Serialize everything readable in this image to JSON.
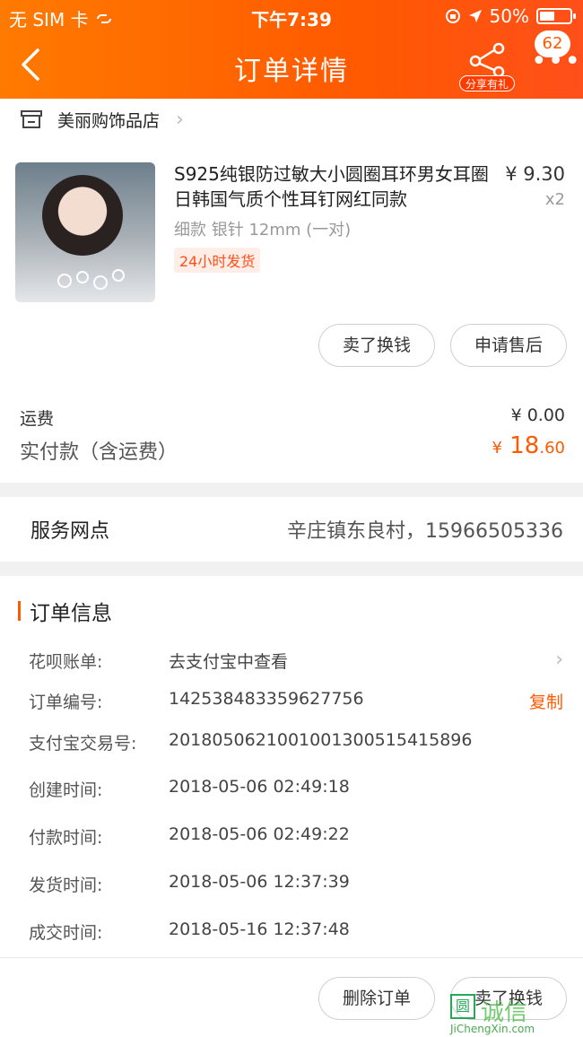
{
  "status_bar": {
    "carrier": "无 SIM 卡",
    "time": "下午7:39",
    "battery": "50%"
  },
  "nav": {
    "title": "订单详情",
    "share_label": "分享有礼",
    "badge": "62"
  },
  "store": {
    "name": "美丽购饰品店"
  },
  "item": {
    "name": "S925纯银防过敏大小圆圈耳环男女耳圈日韩国气质个性耳钉网红同款",
    "spec": "细款 银针 12mm (一对)",
    "tag": "24小时发货",
    "price": "¥ 9.30",
    "qty": "x2",
    "buttons": {
      "sell": "卖了换钱",
      "after_sale": "申请售后"
    }
  },
  "fees": {
    "shipping_label": "运费",
    "shipping_value": "¥ 0.00",
    "paid_label": "实付款（含运费）",
    "paid_symbol": "¥",
    "paid_int": "18",
    "paid_dec": ".60"
  },
  "service": {
    "label": "服务网点",
    "value": "辛庄镇东良村，15966505336"
  },
  "order": {
    "title": "订单信息",
    "rows": [
      {
        "k": "花呗账单:",
        "v": "去支付宝中查看"
      },
      {
        "k": "订单编号:",
        "v": "142538483359627756",
        "action": "复制"
      },
      {
        "k": "支付宝交易号:",
        "v": "2018050621001001300515415896"
      },
      {
        "k": "创建时间:",
        "v": "2018-05-06 02:49:18"
      },
      {
        "k": "付款时间:",
        "v": "2018-05-06 02:49:22"
      },
      {
        "k": "发货时间:",
        "v": "2018-05-06 12:37:39"
      },
      {
        "k": "成交时间:",
        "v": "2018-05-16 12:37:48"
      }
    ]
  },
  "footer": {
    "delete": "删除订单",
    "sell": "卖了换钱"
  },
  "watermark": {
    "brand": "诚信",
    "url": "JiChengXin.com"
  }
}
